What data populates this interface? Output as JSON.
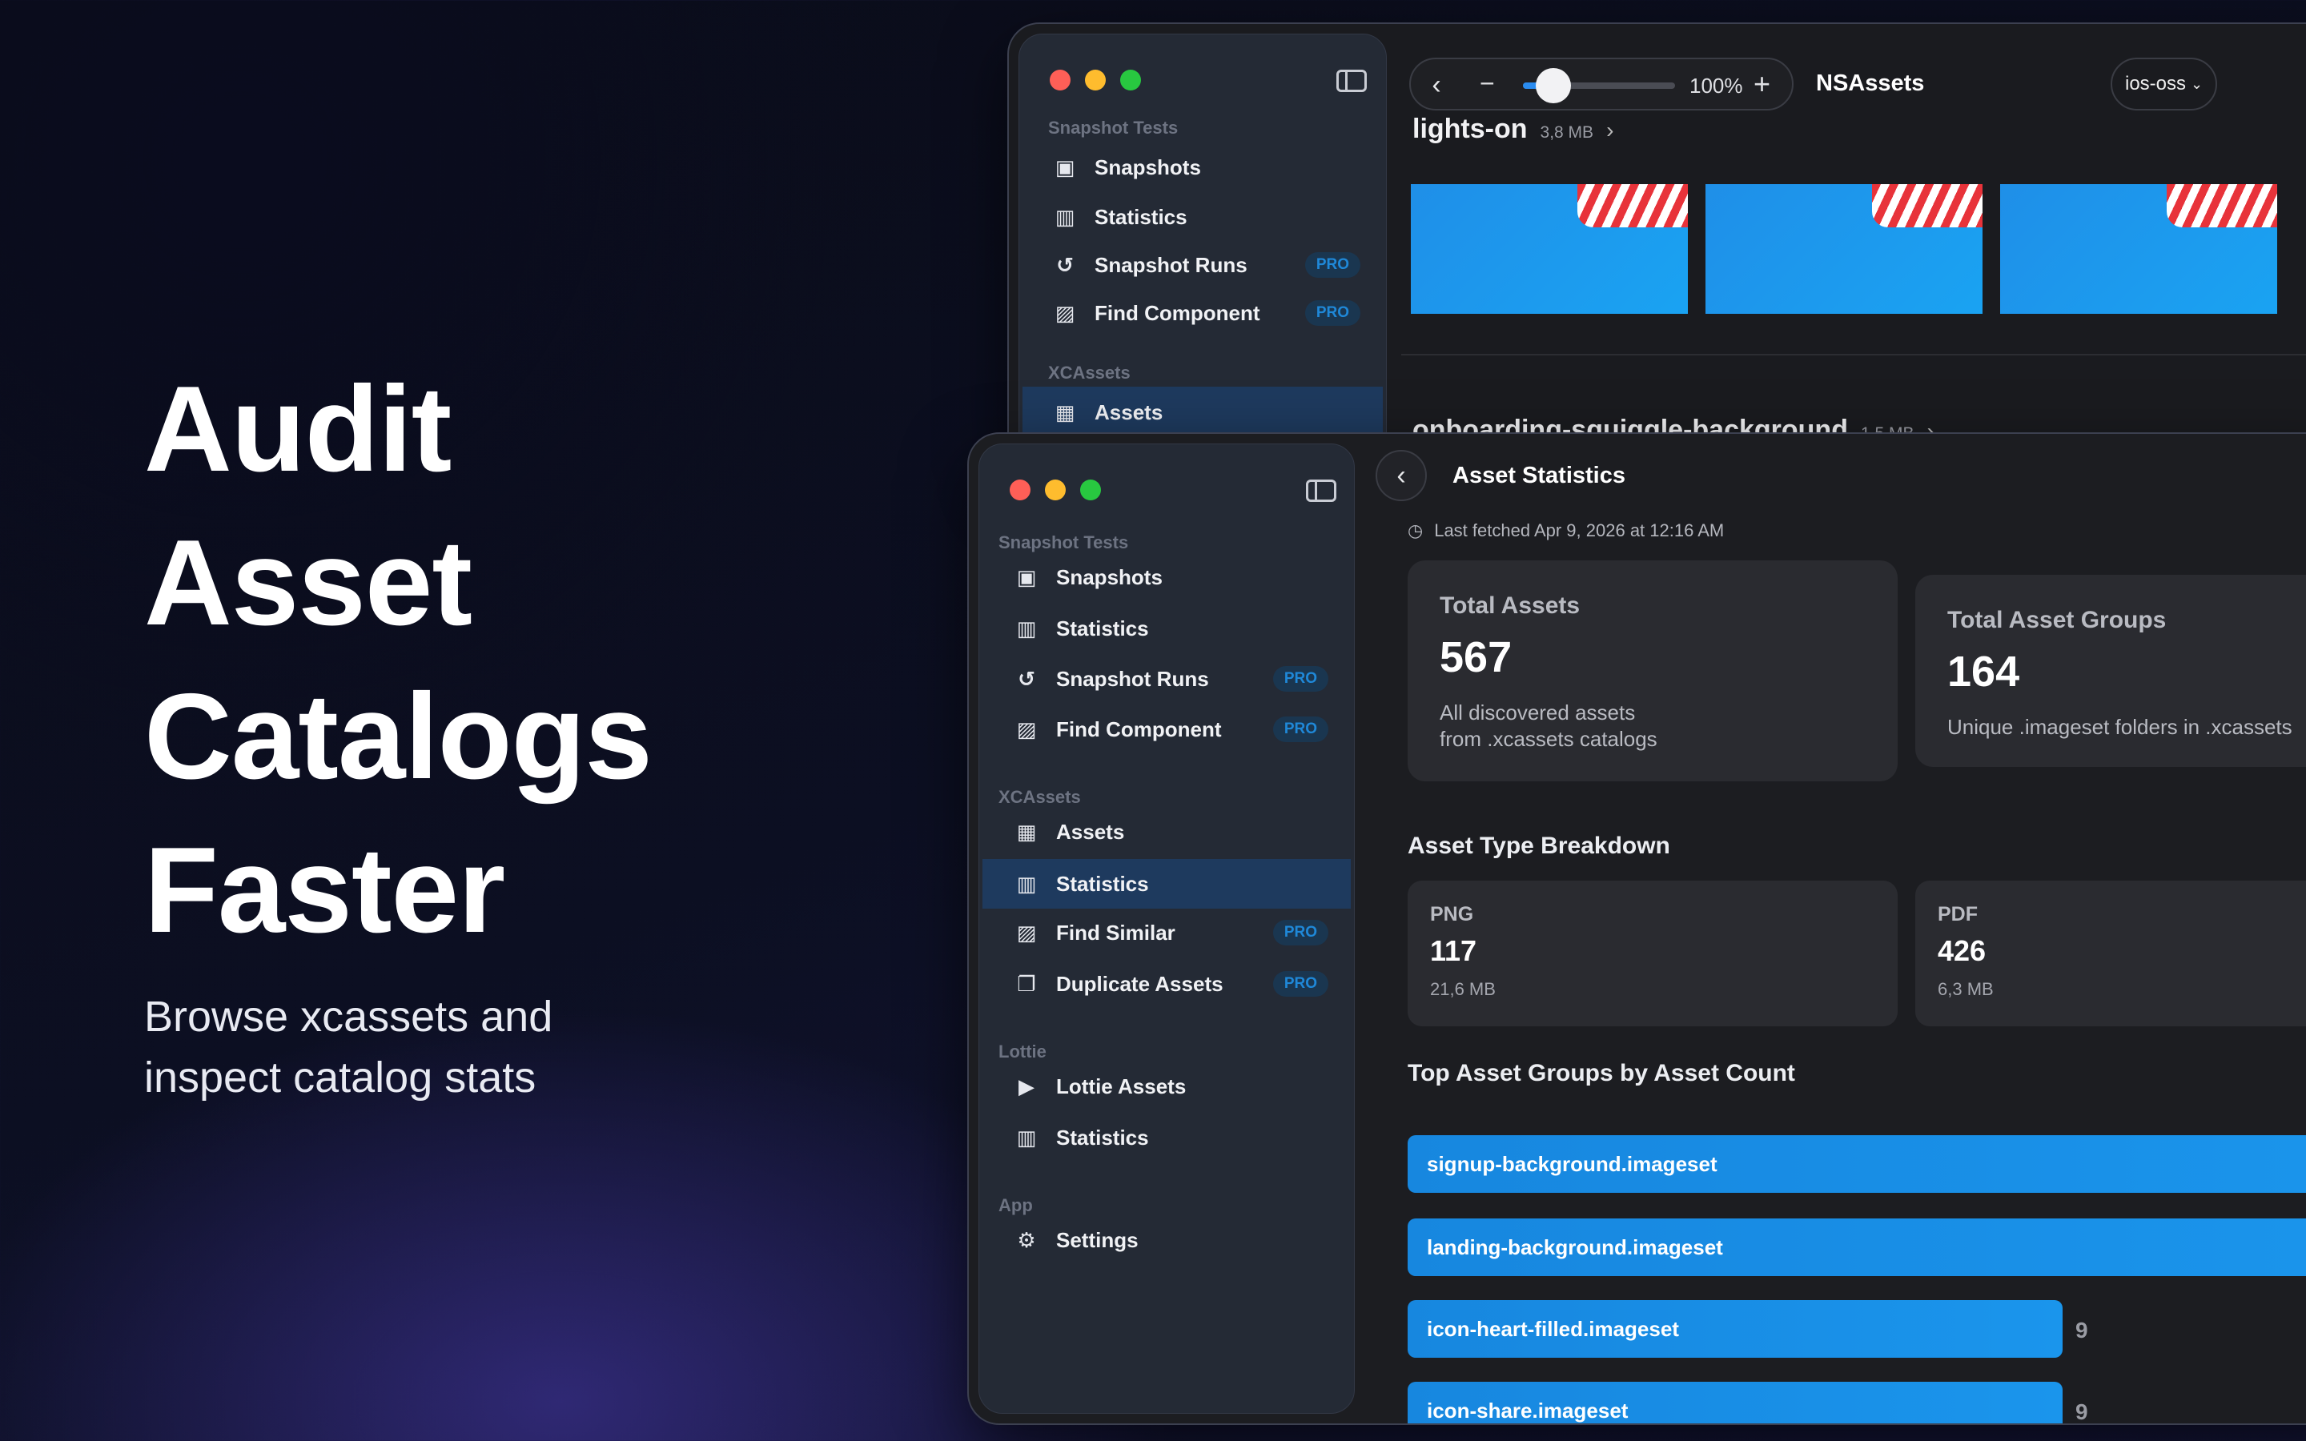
{
  "hero": {
    "title_lines": [
      "Audit",
      "Asset",
      "Catalogs",
      "Faster"
    ],
    "subtitle_lines": [
      "Browse xcassets and",
      "inspect catalog stats"
    ]
  },
  "back_window": {
    "sidebar": {
      "section_snapshot": "Snapshot Tests",
      "items": [
        {
          "label": "Snapshots",
          "icon": "photo-icon"
        },
        {
          "label": "Statistics",
          "icon": "bar-chart-icon"
        },
        {
          "label": "Snapshot Runs",
          "icon": "history-icon",
          "badge": "PRO"
        },
        {
          "label": "Find Component",
          "icon": "image-search-icon",
          "badge": "PRO"
        }
      ],
      "section_xcassets": "XCAssets",
      "active_item": {
        "label": "Assets",
        "icon": "grid-icon"
      }
    },
    "toolbar": {
      "zoom": "100%",
      "zoom_level": 0.2,
      "title": "NSAssets",
      "project": "ios-oss"
    },
    "groups": [
      {
        "name": "lights-on",
        "size": "3,8 MB"
      },
      {
        "name": "onboarding-squiggle-background",
        "size": "1,5 MB"
      }
    ]
  },
  "front_window": {
    "sidebar": {
      "section_snapshot": "Snapshot Tests",
      "snapshot_items": [
        {
          "label": "Snapshots",
          "icon": "photo-icon"
        },
        {
          "label": "Statistics",
          "icon": "bar-chart-icon"
        },
        {
          "label": "Snapshot Runs",
          "icon": "history-icon",
          "badge": "PRO"
        },
        {
          "label": "Find Component",
          "icon": "image-search-icon",
          "badge": "PRO"
        }
      ],
      "section_xcassets": "XCAssets",
      "xcassets_items": [
        {
          "label": "Assets",
          "icon": "grid-icon"
        },
        {
          "label": "Statistics",
          "icon": "bar-chart-icon",
          "active": true
        },
        {
          "label": "Find Similar",
          "icon": "image-search-icon",
          "badge": "PRO"
        },
        {
          "label": "Duplicate Assets",
          "icon": "duplicate-icon",
          "badge": "PRO"
        }
      ],
      "section_lottie": "Lottie",
      "lottie_items": [
        {
          "label": "Lottie Assets",
          "icon": "play-icon"
        },
        {
          "label": "Statistics",
          "icon": "bar-chart-icon"
        }
      ],
      "section_app": "App",
      "app_items": [
        {
          "label": "Settings",
          "icon": "gear-icon"
        }
      ]
    },
    "title": "Asset Statistics",
    "last_fetched": "Last fetched  Apr 9, 2026 at 12:16 AM",
    "cards": [
      {
        "label": "Total Assets",
        "value": "567",
        "desc": [
          "All discovered assets",
          "from .xcassets catalogs"
        ]
      },
      {
        "label": "Total Asset Groups",
        "value": "164",
        "desc": [
          "Unique .imageset folders in .xcassets"
        ]
      }
    ],
    "breakdown_title": "Asset Type Breakdown",
    "breakdown": [
      {
        "type": "PNG",
        "count": "117",
        "size": "21,6 MB"
      },
      {
        "type": "PDF",
        "count": "426",
        "size": "6,3 MB"
      }
    ],
    "top_groups_title": "Top Asset Groups by Asset Count",
    "top_groups": [
      {
        "name": "signup-background.imageset",
        "count": ""
      },
      {
        "name": "landing-background.imageset",
        "count": ""
      },
      {
        "name": "icon-heart-filled.imageset",
        "count": "9"
      },
      {
        "name": "icon-share.imageset",
        "count": "9"
      }
    ]
  },
  "colors": {
    "accent": "#1a8fe6",
    "pro_badge": "#1f88d8",
    "active_row": "#1e3a5e"
  }
}
